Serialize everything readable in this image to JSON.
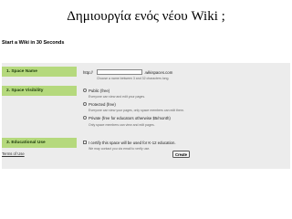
{
  "slide": {
    "title": "Δημιουργία ενός νέου Wiki ;"
  },
  "wiki": {
    "heading": "Start a Wiki in 30 Seconds",
    "space_name": {
      "label": "1. Space Name",
      "prefix": "http://",
      "suffix": ".wikispaces.com",
      "value": "",
      "hint": "Choose a name between 3 and 32 characters long."
    },
    "visibility": {
      "label": "2. Space Visibility",
      "options": [
        {
          "label": "Public (free)",
          "desc": "Everyone can view and edit your pages."
        },
        {
          "label": "Protected (free)",
          "desc": "Everyone can view your pages, only space members can edit them."
        },
        {
          "label": "Private (free for educators otherwise $5/month)",
          "desc": "Only space members can view and edit pages."
        }
      ]
    },
    "educational": {
      "label": "3. Educational Use",
      "checkbox_label": "I certify this space will be used for K-12 education.",
      "desc": "We may contact you via email to verify use."
    },
    "terms_link": "Terms of Use",
    "create_button": "Create"
  }
}
